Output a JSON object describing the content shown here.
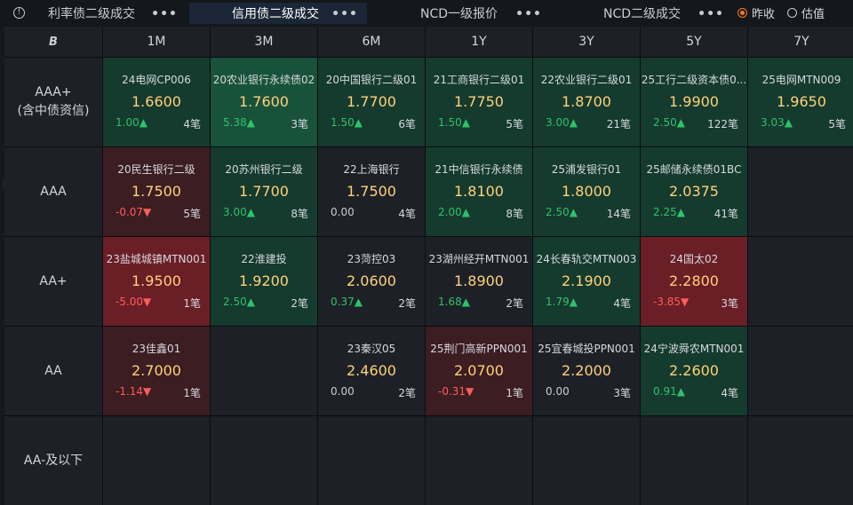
{
  "tabs": [
    {
      "label": "利率债二级成交",
      "active": false
    },
    {
      "label": "信用债二级成交",
      "active": true
    },
    {
      "label": "NCD一级报价",
      "active": false
    },
    {
      "label": "NCD二级成交",
      "active": false
    }
  ],
  "more_label": "•••",
  "options": {
    "yesterday_label": "昨收",
    "estimate_label": "估值",
    "selected": "yesterday_label"
  },
  "corner_logo": "B",
  "columns": [
    "1M",
    "3M",
    "6M",
    "1Y",
    "3Y",
    "5Y",
    "7Y"
  ],
  "rows": [
    {
      "label": "AAA+\n(含中债资信)",
      "cells": [
        {
          "name": "24电网CP006",
          "price": "1.6600",
          "change": "1.00▲",
          "count": "4笔",
          "dir": "pos",
          "tone": "up"
        },
        {
          "name": "20农业银行永续债02",
          "price": "1.7600",
          "change": "5.38▲",
          "count": "3笔",
          "dir": "pos",
          "tone": "up strong"
        },
        {
          "name": "20中国银行二级01",
          "price": "1.7700",
          "change": "1.50▲",
          "count": "6笔",
          "dir": "pos",
          "tone": "up"
        },
        {
          "name": "21工商银行二级01",
          "price": "1.7750",
          "change": "1.50▲",
          "count": "5笔",
          "dir": "pos",
          "tone": "up"
        },
        {
          "name": "22农业银行二级01",
          "price": "1.8700",
          "change": "3.00▲",
          "count": "21笔",
          "dir": "pos",
          "tone": "up"
        },
        {
          "name": "25工行二级资本债0...",
          "price": "1.9900",
          "change": "2.50▲",
          "count": "122笔",
          "dir": "pos",
          "tone": "up"
        },
        {
          "name": "25电网MTN009",
          "price": "1.9650",
          "change": "3.03▲",
          "count": "5笔",
          "dir": "pos",
          "tone": "up"
        }
      ]
    },
    {
      "label": "AAA",
      "cells": [
        {
          "name": "20民生银行二级",
          "price": "1.7500",
          "change": "-0.07▼",
          "count": "5笔",
          "dir": "neg",
          "tone": "down"
        },
        {
          "name": "20苏州银行二级",
          "price": "1.7700",
          "change": "3.00▲",
          "count": "8笔",
          "dir": "pos",
          "tone": "up"
        },
        {
          "name": "22上海银行",
          "price": "1.7500",
          "change": "0.00",
          "count": "4笔",
          "dir": "flat",
          "tone": ""
        },
        {
          "name": "21中信银行永续债",
          "price": "1.8100",
          "change": "2.00▲",
          "count": "8笔",
          "dir": "pos",
          "tone": "up"
        },
        {
          "name": "25浦发银行01",
          "price": "1.8000",
          "change": "2.50▲",
          "count": "14笔",
          "dir": "pos",
          "tone": "up"
        },
        {
          "name": "25邮储永续债01BC",
          "price": "2.0375",
          "change": "2.25▲",
          "count": "41笔",
          "dir": "pos",
          "tone": "up"
        },
        null
      ]
    },
    {
      "label": "AA+",
      "cells": [
        {
          "name": "23盐城城镇MTN001",
          "price": "1.9500",
          "change": "-5.00▼",
          "count": "1笔",
          "dir": "neg",
          "tone": "down strong"
        },
        {
          "name": "22淮建投",
          "price": "1.9200",
          "change": "2.50▲",
          "count": "2笔",
          "dir": "pos",
          "tone": "up"
        },
        {
          "name": "23菏控03",
          "price": "2.0600",
          "change": "0.37▲",
          "count": "2笔",
          "dir": "pos",
          "tone": ""
        },
        {
          "name": "23湖州经开MTN001",
          "price": "1.8900",
          "change": "1.68▲",
          "count": "2笔",
          "dir": "pos",
          "tone": ""
        },
        {
          "name": "24长春轨交MTN003",
          "price": "2.1900",
          "change": "1.79▲",
          "count": "4笔",
          "dir": "pos",
          "tone": "up"
        },
        {
          "name": "24国太02",
          "price": "2.2800",
          "change": "-3.85▼",
          "count": "3笔",
          "dir": "neg",
          "tone": "down strong"
        },
        null
      ]
    },
    {
      "label": "AA",
      "cells": [
        {
          "name": "23佳鑫01",
          "price": "2.7000",
          "change": "-1.14▼",
          "count": "1笔",
          "dir": "neg",
          "tone": "down"
        },
        null,
        {
          "name": "23秦汉05",
          "price": "2.4600",
          "change": "0.00",
          "count": "2笔",
          "dir": "flat",
          "tone": ""
        },
        {
          "name": "25荆门高新PPN001",
          "price": "2.0700",
          "change": "-0.31▼",
          "count": "1笔",
          "dir": "neg",
          "tone": "down"
        },
        {
          "name": "25宜春城投PPN001",
          "price": "2.2000",
          "change": "0.00",
          "count": "3笔",
          "dir": "flat",
          "tone": ""
        },
        {
          "name": "24宁波舜农MTN001",
          "price": "2.2600",
          "change": "0.91▲",
          "count": "4笔",
          "dir": "pos",
          "tone": "up"
        },
        null
      ]
    },
    {
      "label": "AA-及以下",
      "cells": [
        null,
        null,
        null,
        null,
        null,
        null,
        null
      ]
    }
  ],
  "colors": {
    "accent": "#ff7a22",
    "price": "#ffd27a",
    "up": "#2ec26a",
    "down": "#ff5c5c"
  }
}
